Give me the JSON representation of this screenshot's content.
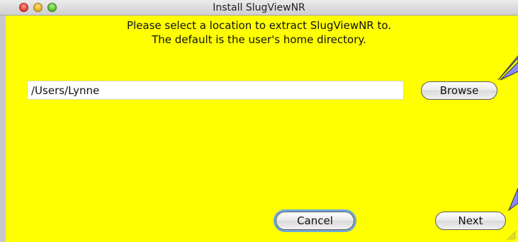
{
  "window": {
    "title": "Install SlugViewNR"
  },
  "instructions": {
    "line1": "Please select a location to extract SlugViewNR to.",
    "line2": "The default is the user's home directory."
  },
  "path_field": {
    "value": "/Users/Lynne"
  },
  "buttons": {
    "browse": "Browse",
    "cancel": "Cancel",
    "next": "Next"
  },
  "colors": {
    "background": "#ffff00",
    "focus_ring": "#6fa8dc",
    "arrow": "#8a8aff"
  },
  "icons": {
    "close": "close-icon",
    "minimize": "minimize-icon",
    "zoom": "zoom-icon",
    "pointer_arrows": "arrow-icon",
    "resize": "resize-grip-icon"
  }
}
